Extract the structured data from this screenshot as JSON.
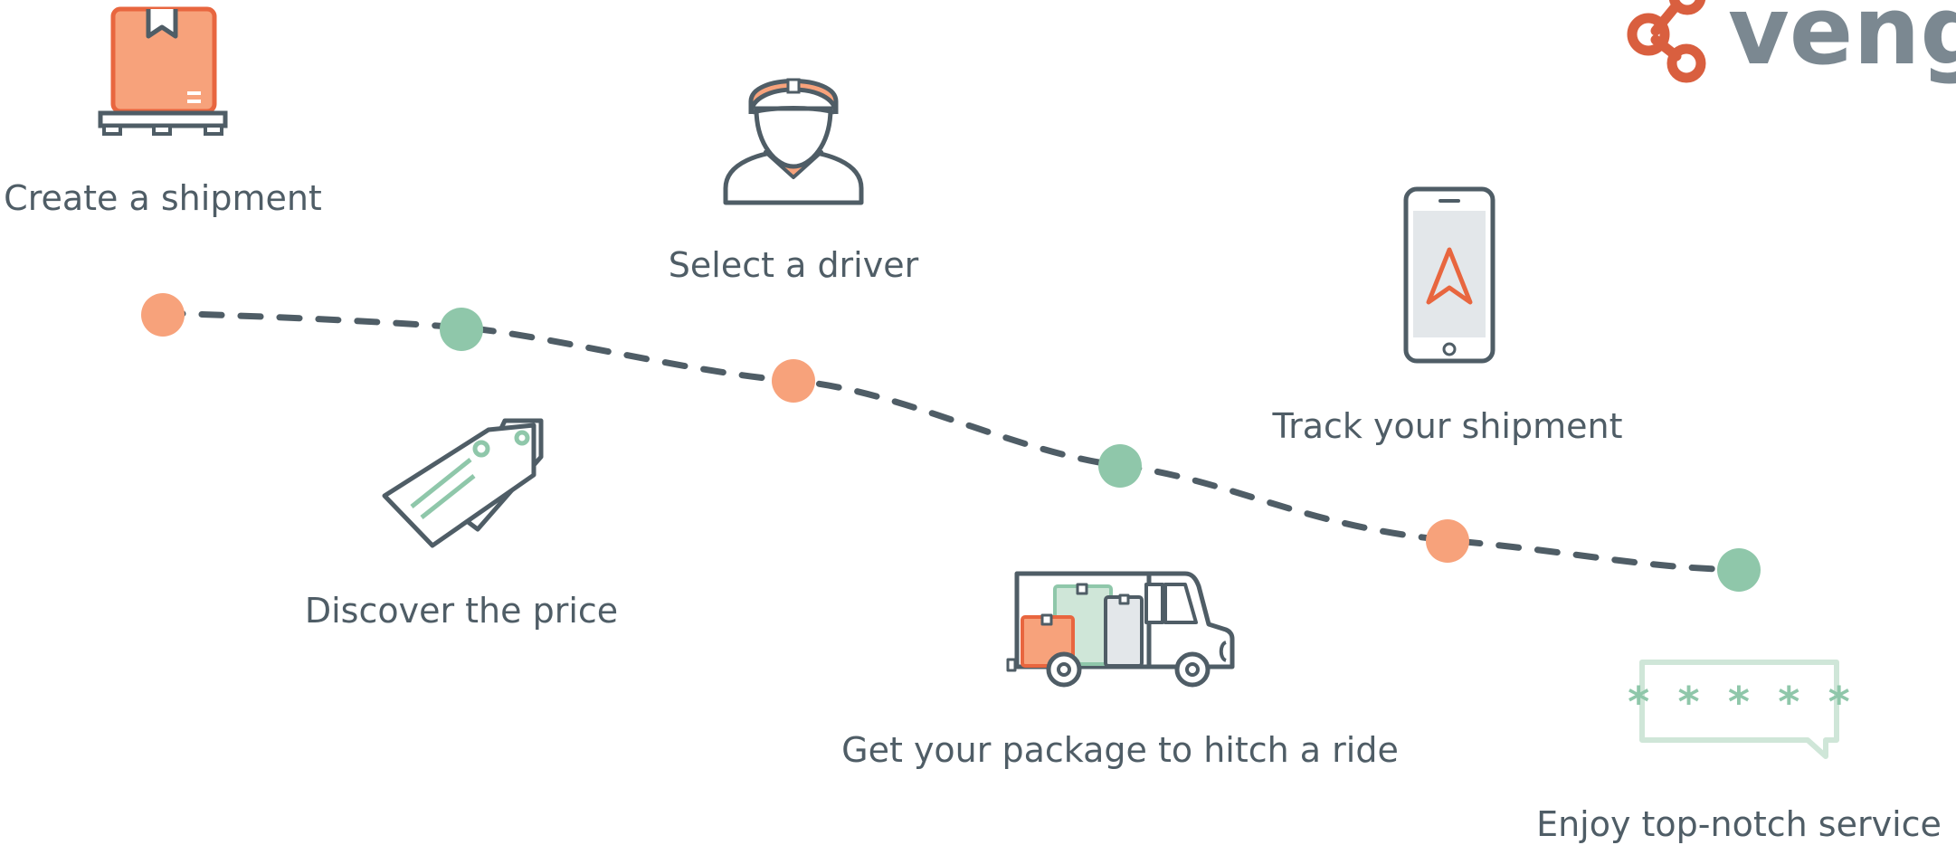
{
  "brand": {
    "name": "vengo",
    "logo_color": "#d95f3f",
    "text_color": "#7b8891"
  },
  "colors": {
    "orange": "#f7a27b",
    "orange_stroke": "#e8663f",
    "green": "#8fc7aa",
    "green_light": "#cfe6d8",
    "slate": "#4f5d66",
    "screen": "#e3e7ea"
  },
  "steps": [
    {
      "label": "Create a shipment",
      "icon": "package-on-pallet-icon",
      "dot_color": "orange"
    },
    {
      "label": "Discover the price",
      "icon": "price-tags-icon",
      "dot_color": "green"
    },
    {
      "label": "Select a driver",
      "icon": "driver-icon",
      "dot_color": "orange"
    },
    {
      "label": "Get your package to hitch a ride",
      "icon": "delivery-van-icon",
      "dot_color": "green"
    },
    {
      "label": "Track your shipment",
      "icon": "smartphone-navigation-icon",
      "dot_color": "orange"
    },
    {
      "label": "Enjoy top-notch service",
      "icon": "rating-bubble-icon",
      "dot_color": "green"
    }
  ],
  "rating": {
    "stars": "* * * * *"
  }
}
